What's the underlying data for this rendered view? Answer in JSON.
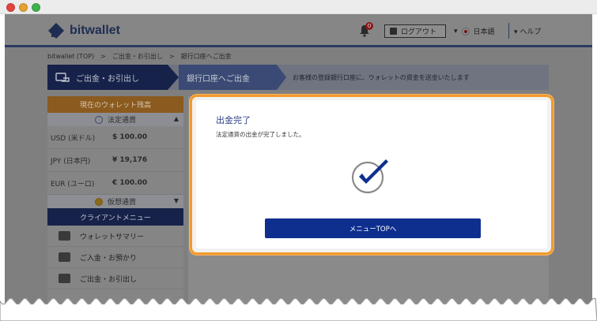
{
  "site": {
    "brand": "bitwallet",
    "notification_count": "0",
    "logout_label": "ログアウト",
    "language_label": "日本語",
    "help_label": "ヘルプ"
  },
  "breadcrumb": "bitwallet (TOP)　>　ご出金・お引出し　>　銀行口座へご出金",
  "steps": {
    "step1": "ご出金・お引出し",
    "step2": "銀行口座へご出金",
    "step3": "お客様の登録銀行口座に、ウォレットの資金を送金いたします"
  },
  "sidebar": {
    "balance_header": "現在のウォレット残高",
    "fiat_label": "法定通貨",
    "balances": [
      {
        "currency": "USD (米ドル)",
        "amount": "$ 100.00"
      },
      {
        "currency": "JPY (日本円)",
        "amount": "¥ 19,176"
      },
      {
        "currency": "EUR (ユーロ)",
        "amount": "€ 100.00"
      }
    ],
    "crypto_label": "仮想通貨",
    "menu_header": "クライアントメニュー",
    "menu_items": [
      {
        "label": "ウォレットサマリー"
      },
      {
        "label": "ご入金・お預かり"
      },
      {
        "label": "ご出金・お引出し"
      }
    ]
  },
  "modal": {
    "title": "出金完了",
    "message": "法定通貨の出金が完了しました。",
    "button_label": "メニューTOPへ"
  },
  "colors": {
    "accent_orange": "#f39a2c",
    "brand_navy": "#0f2f8f",
    "title_blue": "#2a3f86"
  }
}
